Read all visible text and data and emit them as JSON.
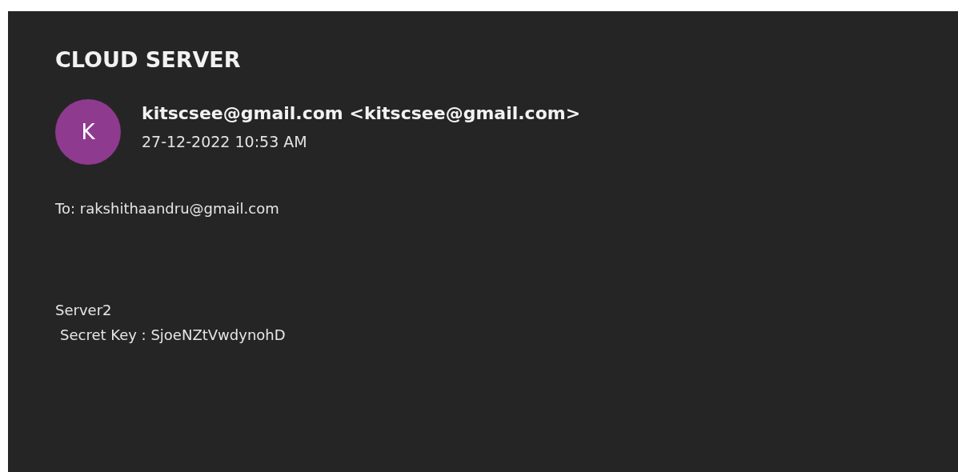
{
  "subject": "CLOUD SERVER",
  "sender": {
    "initial": "K",
    "color": "#8e3a8f",
    "name": "kitscsee@gmail.com <kitscsee@gmail.com>",
    "date": "27-12-2022 10:53 AM"
  },
  "to": "To: rakshithaandru@gmail.com",
  "body": [
    "Server2",
    "Secret Key : SjoeNZtVwdynohD"
  ]
}
